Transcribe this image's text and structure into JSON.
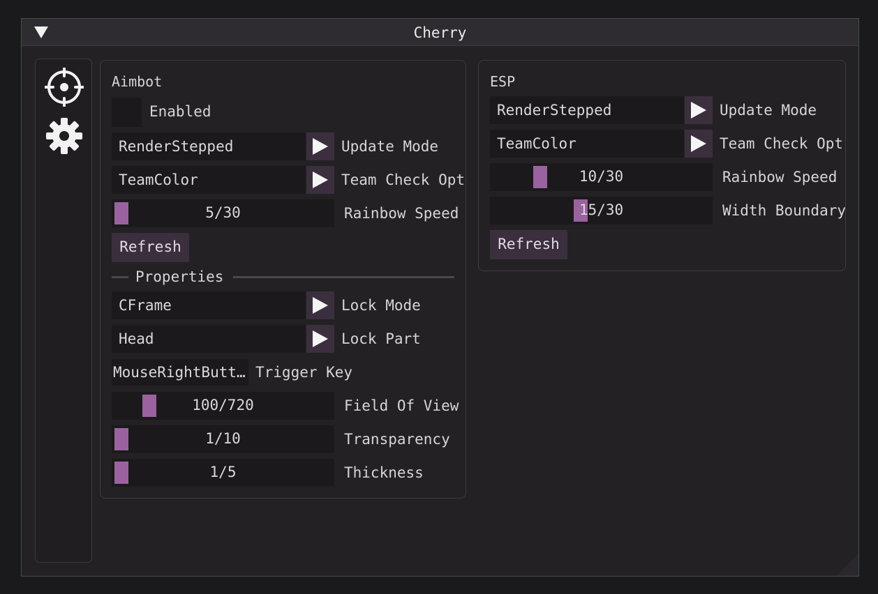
{
  "window": {
    "title": "Cherry"
  },
  "sidebar": {
    "items": [
      {
        "icon": "crosshair-icon"
      },
      {
        "icon": "gear-icon"
      }
    ]
  },
  "aimbot": {
    "title": "Aimbot",
    "enabled": {
      "label": "Enabled",
      "checked": false
    },
    "update_mode": {
      "value": "RenderStepped",
      "label": "Update Mode"
    },
    "team_check": {
      "value": "TeamColor",
      "label": "Team Check Opt"
    },
    "rainbow_speed": {
      "value": 5,
      "max": 30,
      "display": "5/30",
      "label": "Rainbow Speed"
    },
    "refresh_label": "Refresh",
    "properties_label": "Properties",
    "lock_mode": {
      "value": "CFrame",
      "label": "Lock Mode"
    },
    "lock_part": {
      "value": "Head",
      "label": "Lock Part"
    },
    "trigger_key": {
      "value": "MouseRightButt…",
      "label": "Trigger Key"
    },
    "fov": {
      "value": 100,
      "max": 720,
      "display": "100/720",
      "label": "Field Of View"
    },
    "transparency": {
      "value": 1,
      "max": 10,
      "display": "1/10",
      "label": "Transparency"
    },
    "thickness": {
      "value": 1,
      "max": 5,
      "display": "1/5",
      "label": "Thickness"
    }
  },
  "esp": {
    "title": "ESP",
    "update_mode": {
      "value": "RenderStepped",
      "label": "Update Mode"
    },
    "team_check": {
      "value": "TeamColor",
      "label": "Team Check Opt"
    },
    "rainbow_speed": {
      "value": 10,
      "max": 30,
      "display": "10/30",
      "label": "Rainbow Speed"
    },
    "width_boundary": {
      "value": 15,
      "max": 30,
      "display": "15/30",
      "label": "Width Boundary"
    },
    "refresh_label": "Refresh"
  },
  "colors": {
    "accent": "#9b62a0",
    "button_bg": "#3b2f3e",
    "frame_bg": "#1b191c",
    "window_bg": "#232124"
  }
}
